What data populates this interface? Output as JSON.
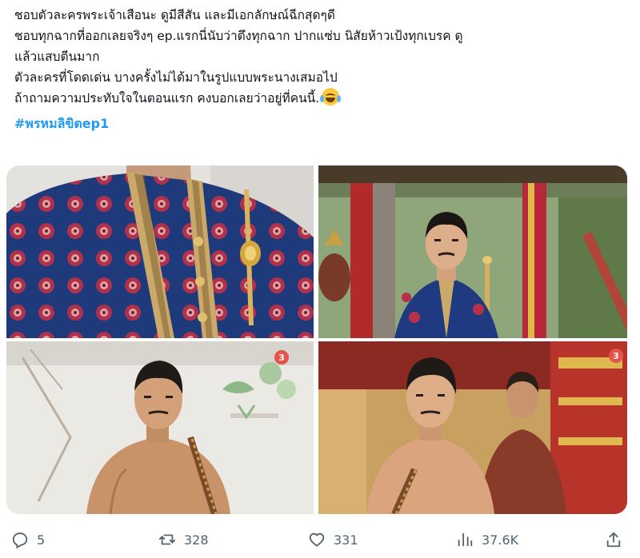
{
  "post": {
    "lines": [
      "ชอบตัวละครพระเจ้าเสือนะ ดูมีสีสัน และมีเอกลักษณ์ฉีกสุดๆดี",
      "ชอบทุกฉากที่ออกเลยจริงๆ ep.แรกนี่นับว่าตึงทุกฉาก ปากแซ่บ นิสัยห้าวเป้งทุกเบรค ดู",
      "แล้วแสบตีนมาก",
      "ตัวละครที่โดดเด่น บางครั้งไม่ได้มาในรูปแบบพระนางเสมอไป",
      "ถ้าถามความประทับใจในตอนแรก คงบอกเลยว่าอยู่ที่คนนี้."
    ],
    "emoji": "face-with-tears-of-joy",
    "hashtag": "#พรหมลิขิตep1"
  },
  "media": {
    "items": [
      {
        "name": "close-up of royal costume"
      },
      {
        "name": "man in royal costume on palanquin"
      },
      {
        "name": "shirtless man with mustache"
      },
      {
        "name": "shirtless man in palace"
      }
    ],
    "channel_logo": "3"
  },
  "actions": {
    "replies": "5",
    "reposts": "328",
    "likes": "331",
    "views": "37.6K"
  },
  "colors": {
    "accent": "#1d9bf0",
    "muted": "#536471",
    "text": "#0f1419"
  }
}
